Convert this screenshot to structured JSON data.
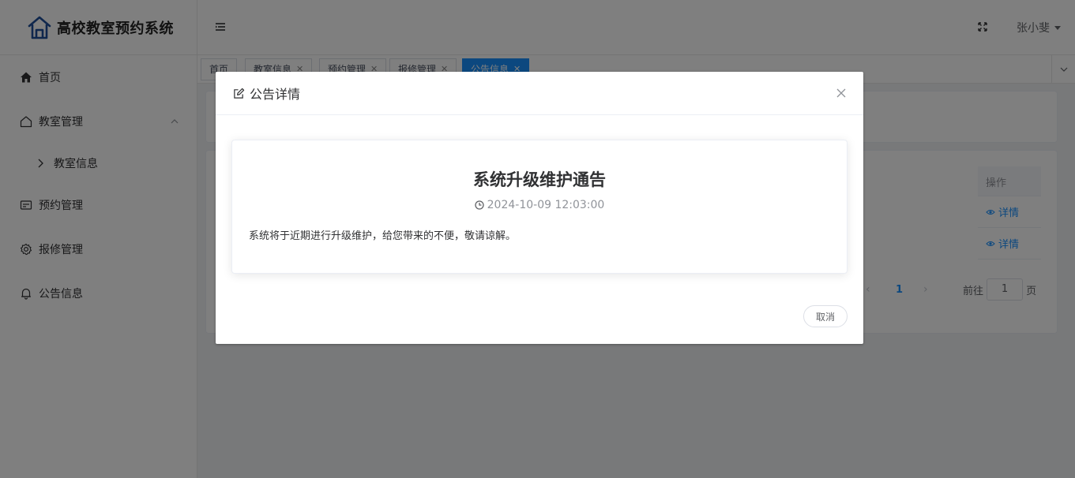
{
  "app": {
    "title": "高校教室预约系统"
  },
  "sidebar": {
    "items": [
      {
        "label": "首页",
        "icon": "home-icon"
      },
      {
        "label": "教室管理",
        "icon": "house-outline-icon",
        "expanded": true,
        "children": [
          {
            "label": "教室信息",
            "icon": "chevron-right-icon"
          }
        ]
      },
      {
        "label": "预约管理",
        "icon": "card-icon"
      },
      {
        "label": "报修管理",
        "icon": "gear-icon"
      },
      {
        "label": "公告信息",
        "icon": "bell-icon"
      }
    ]
  },
  "header": {
    "user": "张小斐"
  },
  "tags": [
    {
      "label": "首页",
      "closable": false
    },
    {
      "label": "教室信息",
      "closable": true
    },
    {
      "label": "预约管理",
      "closable": true
    },
    {
      "label": "报修管理",
      "closable": true
    },
    {
      "label": "公告信息",
      "closable": true,
      "active": true
    }
  ],
  "table": {
    "ops_header": "操作",
    "rows": [
      {
        "action": "详情"
      },
      {
        "action": "详情"
      }
    ]
  },
  "pagination": {
    "current": "1",
    "goto_prefix": "前往",
    "goto_value": "1",
    "goto_suffix": "页"
  },
  "dialog": {
    "title": "公告详情",
    "notice_title": "系统升级维护通告",
    "notice_time": "2024-10-09 12:03:00",
    "notice_content": "系统将于近期进行升级维护，给您带来的不便，敬请谅解。",
    "cancel_label": "取消"
  },
  "colors": {
    "primary": "#1890ff",
    "overlay": "rgba(0,0,0,0.5)"
  }
}
